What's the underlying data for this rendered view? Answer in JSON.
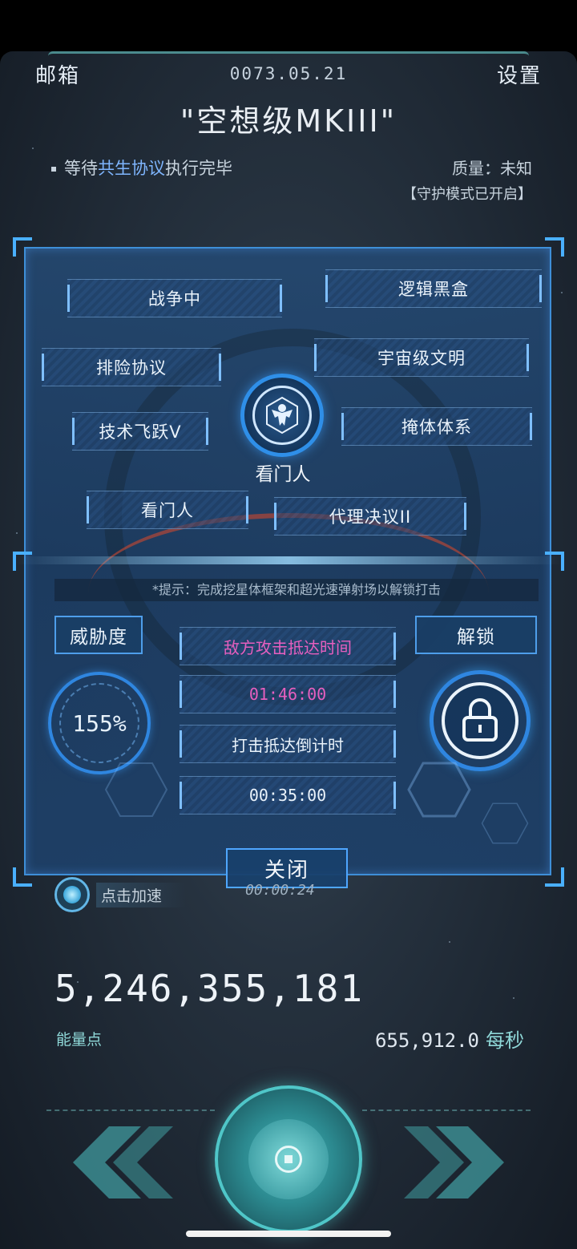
{
  "header": {
    "mailbox_label": "邮箱",
    "date": "0073.05.21",
    "settings_label": "设置",
    "title": "\"空想级MKIII\""
  },
  "status": {
    "prefix": "等待",
    "highlight": "共生协议",
    "suffix": "执行完毕",
    "quality": "质量：未知",
    "guard_mode": "【守护模式已开启】"
  },
  "tags": [
    "战争中",
    "逻辑黑盒",
    "排险协议",
    "宇宙级文明",
    "技术飞跃V",
    "掩体体系",
    "看门人",
    "代理决议II"
  ],
  "emblem": {
    "label": "看门人"
  },
  "hint": "*提示：完成挖星体框架和超光速弹射场以解锁打击",
  "threat": {
    "label": "威胁度",
    "value": "155%"
  },
  "unlock": {
    "label": "解锁"
  },
  "timers": {
    "enemy_label": "敌方攻击抵达时间",
    "enemy_time": "01:46:00",
    "strike_label": "打击抵达倒计时",
    "strike_time": "00:35:00"
  },
  "close_label": "关闭",
  "speed_up": {
    "label": "点击加速",
    "ghost_timer": "00:00:24"
  },
  "energy": {
    "amount": "5,246,355,181",
    "label": "能量点",
    "rate": "655,912.0",
    "rate_unit": "每秒"
  },
  "colors": {
    "accent_blue": "#3e8fd8",
    "enemy_pink": "#e65fbf",
    "teal": "#4fc6c8",
    "link_blue": "#7fb6ff"
  }
}
